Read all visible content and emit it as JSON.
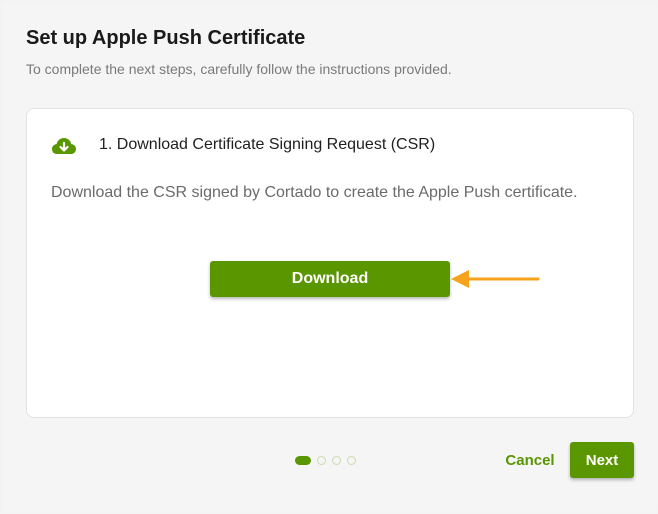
{
  "dialog": {
    "title": "Set up Apple Push Certificate",
    "subtitle": "To complete the next steps, carefully follow the instructions provided."
  },
  "step": {
    "icon": "cloud-download-icon",
    "title": "1. Download Certificate Signing Request (CSR)",
    "description": "Download the CSR signed by Cortado to create the Apple Push certificate.",
    "download_label": "Download"
  },
  "annotation": {
    "arrow_color": "#f7a21b"
  },
  "pagination": {
    "total_steps": 4,
    "current_step": 1
  },
  "footer": {
    "cancel_label": "Cancel",
    "next_label": "Next"
  },
  "colors": {
    "accent": "#5a9600",
    "dot_inactive": "#c9dcae"
  }
}
